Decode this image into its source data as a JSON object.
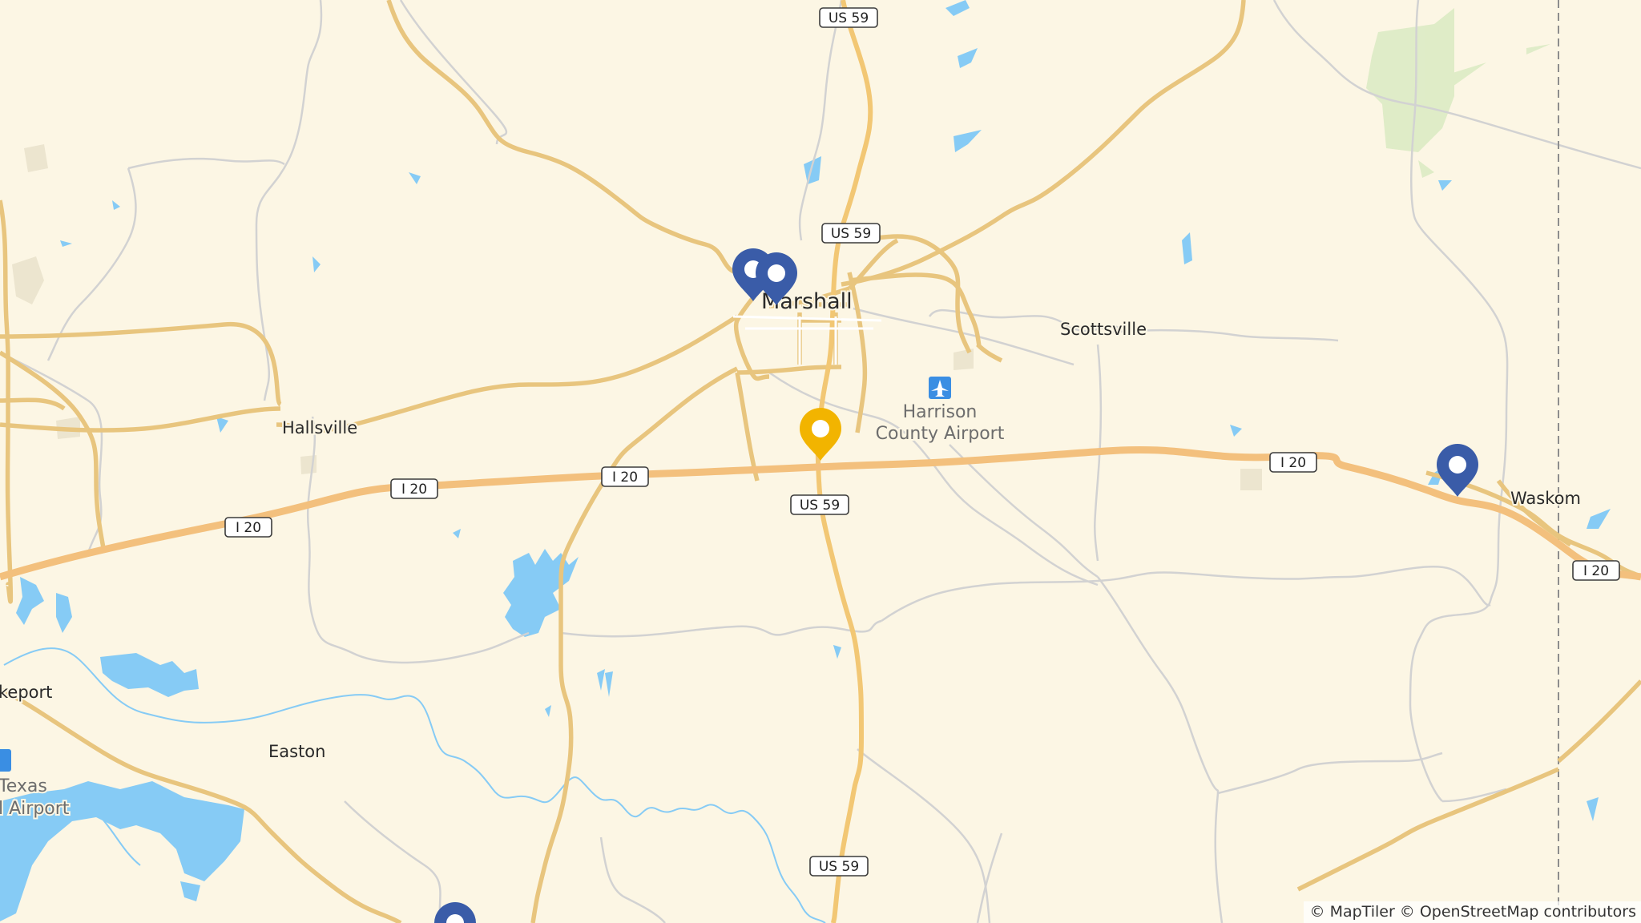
{
  "map": {
    "places": {
      "marshall": "Marshall",
      "scottsville": "Scottsville",
      "hallsville": "Hallsville",
      "waskom": "Waskom",
      "easton": "Easton",
      "longview_partial": "keport"
    },
    "airports": {
      "harrison_line1": "Harrison",
      "harrison_line2": "County Airport",
      "east_texas_line1": "Texas",
      "east_texas_line2": "l Airport"
    },
    "shields": {
      "us59_top": "US 59",
      "us59_mid": "US 59",
      "us59_south": "US 59",
      "us59_bottom": "US 59",
      "i20_a": "I 20",
      "i20_b": "I 20",
      "i20_c": "I 20",
      "i20_d": "I 20",
      "i20_e": "I 20"
    },
    "markers": {
      "blue_color": "#3a5ca8",
      "selected_color": "#f2b400",
      "list": [
        {
          "name": "marker-marshall-1",
          "type": "location"
        },
        {
          "name": "marker-marshall-2",
          "type": "location"
        },
        {
          "name": "marker-waskom",
          "type": "location"
        },
        {
          "name": "marker-selected",
          "type": "selected"
        },
        {
          "name": "marker-south",
          "type": "location"
        }
      ]
    },
    "colors": {
      "land": "#fcf6e4",
      "water": "#86cbf5",
      "highway": "#f6c983",
      "road": "#f6d98c",
      "minor_road": "#d2d2d2",
      "forest": "#dcebc4"
    },
    "attribution": "© MapTiler © OpenStreetMap contributors"
  }
}
